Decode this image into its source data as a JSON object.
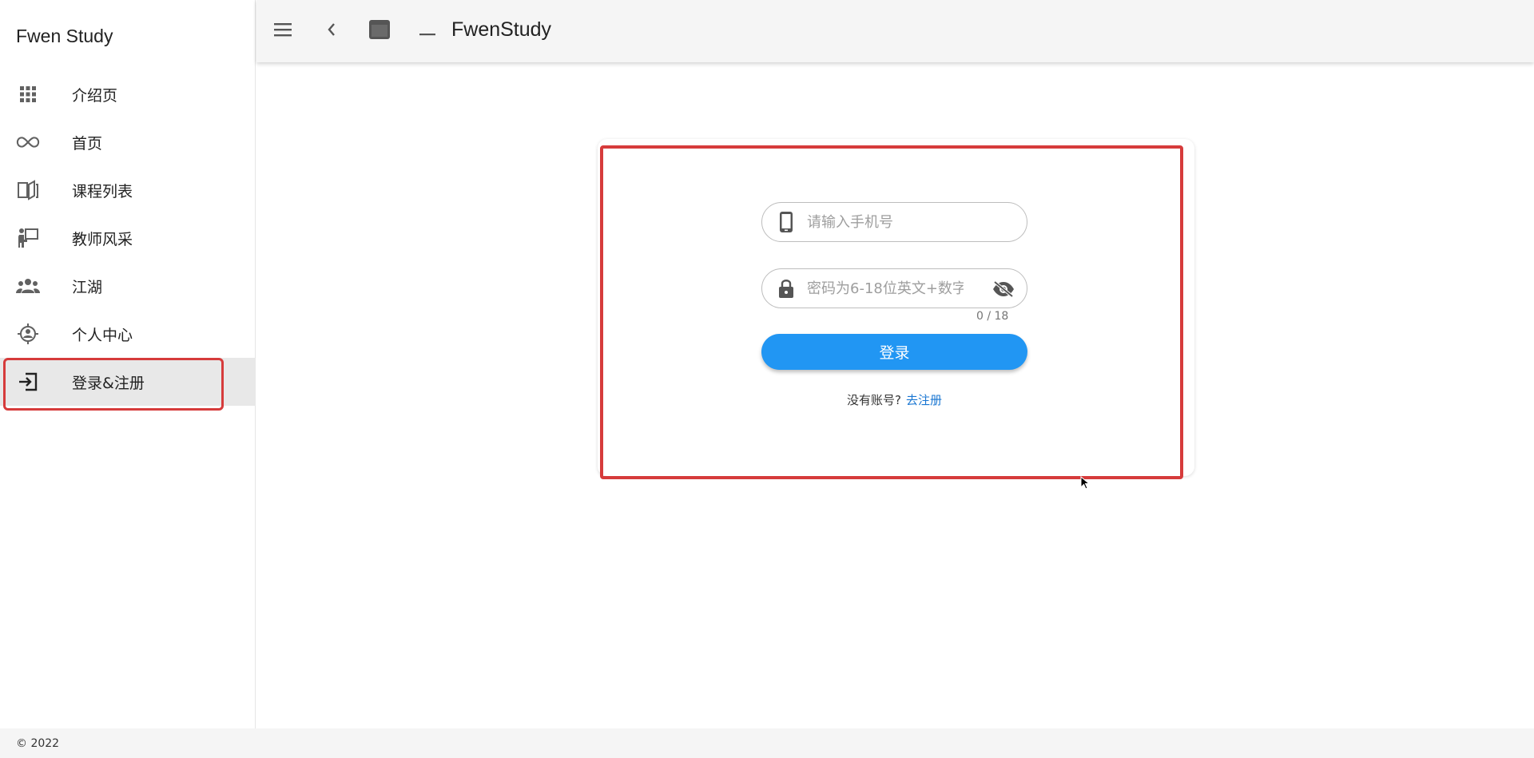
{
  "app": {
    "title": "Fwen Study"
  },
  "sidebar": {
    "items": [
      {
        "label": "介绍页",
        "icon": "apps-grid-icon"
      },
      {
        "label": "首页",
        "icon": "infinity-icon"
      },
      {
        "label": "课程列表",
        "icon": "book-open-icon"
      },
      {
        "label": "教师风采",
        "icon": "teacher-icon"
      },
      {
        "label": "江湖",
        "icon": "people-group-icon"
      },
      {
        "label": "个人中心",
        "icon": "user-target-icon"
      },
      {
        "label": "登录&注册",
        "icon": "login-icon",
        "active": true
      }
    ]
  },
  "toolbar": {
    "title": "FwenStudy",
    "buttons": [
      "menu-icon",
      "back-chevron-icon",
      "window-icon",
      "minimize-icon"
    ]
  },
  "login": {
    "phone_placeholder": "请输入手机号",
    "password_placeholder": "密码为6-18位英文+数字",
    "password_counter": "0 / 18",
    "submit_label": "登录",
    "no_account_text": "没有账号?",
    "register_link": "去注册"
  },
  "footer": {
    "copyright": "© 2022"
  },
  "colors": {
    "accent": "#2196f3",
    "link": "#1976d2",
    "highlight": "#d63b3b",
    "topbar_bg": "#f5f5f5",
    "active_nav_bg": "#e8e8e8"
  }
}
